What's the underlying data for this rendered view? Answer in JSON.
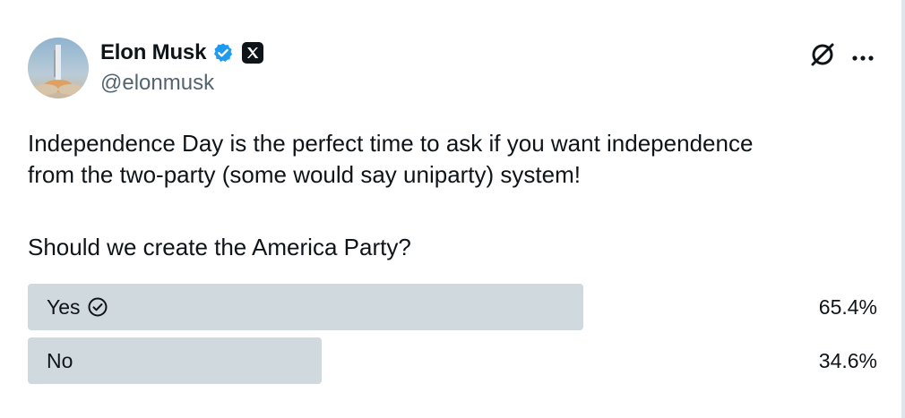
{
  "author": {
    "name": "Elon Musk",
    "handle": "@elonmusk",
    "avatar_icon": "avatar-rocket-launch",
    "verified_icon": "verified-badge-icon",
    "affiliate_icon": "x-logo-icon",
    "verified_color": "#1d9bf0"
  },
  "header_actions": {
    "grok_icon": "grok-icon",
    "more_icon": "more-icon"
  },
  "tweet": {
    "line1": "Independence Day is the perfect time to ask if you want independence",
    "line2": "from the two-party (some would say uniparty) system!",
    "question": "Should we create the America Party?"
  },
  "poll": {
    "options": [
      {
        "label": "Yes",
        "percent_label": "65.4%",
        "percent": 65.4,
        "selected": true
      },
      {
        "label": "No",
        "percent_label": "34.6%",
        "percent": 34.6,
        "selected": false
      }
    ],
    "bar_color": "#cfd9de"
  }
}
